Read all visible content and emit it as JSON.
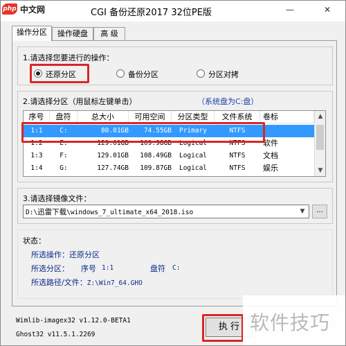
{
  "branding": {
    "logo_text": "php",
    "site_name": "中文网"
  },
  "window": {
    "title": "CGI 备份还原2017 32位PE版",
    "minimize": "—",
    "close": "✕"
  },
  "tabs": [
    {
      "label": "操作分区",
      "active": true
    },
    {
      "label": "操作硬盘",
      "active": false
    },
    {
      "label": "高 级",
      "active": false
    }
  ],
  "step1": {
    "title": "1.请选择您要进行的操作：",
    "options": [
      {
        "label": "还原分区",
        "checked": true
      },
      {
        "label": "备份分区",
        "checked": false
      },
      {
        "label": "分区对拷",
        "checked": false
      }
    ]
  },
  "step2": {
    "title": "2.请选择分区（用鼠标左键单击）",
    "system_disk_note": "（系统盘为C:盘）",
    "columns": [
      "序号",
      "盘符",
      "总大小",
      "可用空间",
      "分区类型",
      "文件系统",
      "卷标"
    ],
    "rows": [
      {
        "index": "1:1",
        "drive": "C:",
        "total": "80.01GB",
        "free": "74.55GB",
        "type": "Primary",
        "fs": "NTFS",
        "label": "",
        "selected": true
      },
      {
        "index": "1:2",
        "drive": "E:",
        "total": "129.01GB",
        "free": "109.98GB",
        "type": "Logical",
        "fs": "NTFS",
        "label": "软件",
        "selected": false
      },
      {
        "index": "1:3",
        "drive": "F:",
        "total": "129.01GB",
        "free": "108.49GB",
        "type": "Logical",
        "fs": "NTFS",
        "label": "文档",
        "selected": false
      },
      {
        "index": "1:4",
        "drive": "G:",
        "total": "127.74GB",
        "free": "109.87GB",
        "type": "Logical",
        "fs": "NTFS",
        "label": "娱乐",
        "selected": false
      }
    ]
  },
  "step3": {
    "title": "3.请选择镜像文件：",
    "file_prefix": "D:\\",
    "file_folder": "迅雷下载",
    "file_rest": "\\windows_7_ultimate_x64_2018.iso",
    "browse_label": "..."
  },
  "status": {
    "title": "状态：",
    "operation_label": "所选操作：",
    "operation_value": "还原分区",
    "partition_label": "所选分区：",
    "partition_index_label": "序号",
    "partition_index_value": "1:1",
    "drive_label": "盘符",
    "drive_value": "C:",
    "path_label": "所选路径/文件：",
    "path_value": "Z:\\Win7_64.GHO"
  },
  "footer": {
    "wimlib": "Wimlib-imagex32 v1.12.0-BETA1",
    "ghost": "Ghost32 v11.5.1.2269"
  },
  "execute_label": "执 行",
  "watermark": "软件技巧",
  "colors": {
    "selection": "#3399ff",
    "highlight_border": "#d82626",
    "status_text": "#0a2a8a"
  }
}
